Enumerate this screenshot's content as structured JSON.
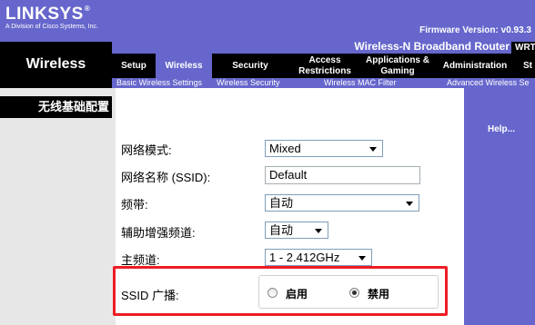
{
  "brand": {
    "logo": "LINKSYS",
    "registered": "®",
    "tagline": "A Division of Cisco Systems, Inc."
  },
  "firmware": "Firmware Version: v0.93.3",
  "section_title": "Wireless",
  "router": {
    "name": "Wireless-N Broadband Router",
    "model": "WRT"
  },
  "tabs": [
    {
      "label": "Setup"
    },
    {
      "label": "Wireless"
    },
    {
      "label": "Security"
    },
    {
      "label": "Access Restrictions"
    },
    {
      "label": "Applications & Gaming"
    },
    {
      "label": "Administration"
    },
    {
      "label": "St"
    }
  ],
  "subtabs": [
    {
      "label": "Basic Wireless Settings"
    },
    {
      "label": "Wireless Security"
    },
    {
      "label": "Wireless MAC Filter"
    },
    {
      "label": "Advanced Wireless Se"
    }
  ],
  "left_heading": "无线基础配置",
  "help": "Help...",
  "form": {
    "network_mode": {
      "label": "网络模式:",
      "value": "Mixed"
    },
    "ssid": {
      "label": "网络名称 (SSID):",
      "value": "Default"
    },
    "band": {
      "label": "频带:",
      "value": "自动"
    },
    "ext_channel": {
      "label": "辅助增强频道:",
      "value": "自动"
    },
    "channel": {
      "label": "主频道:",
      "value": "1 - 2.412GHz"
    },
    "ssid_broadcast": {
      "label": "SSID 广播:",
      "options": [
        {
          "label": "启用",
          "selected": false
        },
        {
          "label": "禁用",
          "selected": true
        }
      ]
    }
  },
  "colors": {
    "brand": "#6666cc",
    "highlight": "#ee1c24"
  }
}
